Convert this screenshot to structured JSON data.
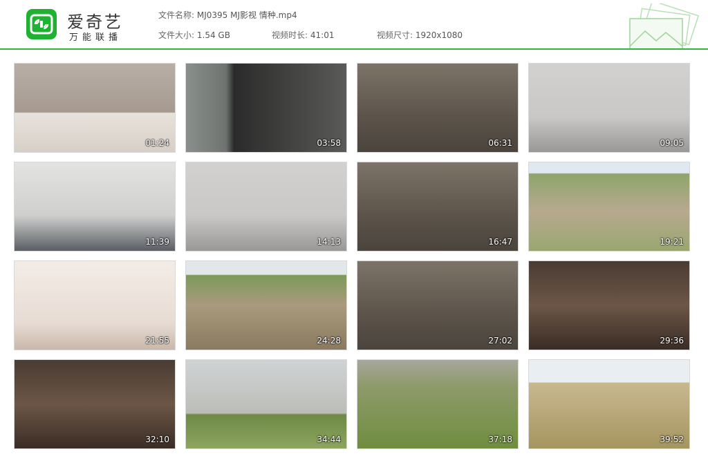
{
  "app": {
    "logo_title": "爱奇艺",
    "logo_subtitle": "万能联播",
    "brand_color": "#1fb232",
    "logo_icon": "iqiyi-tv-icon"
  },
  "file_info": {
    "name_label": "文件名称:",
    "name_value": "MJ0395 MJ影视 情种.mp4",
    "size_label": "文件大小:",
    "size_value": "1.54 GB",
    "duration_label": "视频时长:",
    "duration_value": "41:01",
    "resolution_label": "视频尺寸:",
    "resolution_value": "1920x1080"
  },
  "thumbnails": [
    {
      "time": "01:24",
      "scene": "s-bedroom"
    },
    {
      "time": "03:58",
      "scene": "s-corridor"
    },
    {
      "time": "06:31",
      "scene": "s-cell"
    },
    {
      "time": "09:05",
      "scene": "s-grayroom"
    },
    {
      "time": "11:39",
      "scene": "s-office"
    },
    {
      "time": "14:13",
      "scene": "s-grayroom"
    },
    {
      "time": "16:47",
      "scene": "s-cell"
    },
    {
      "time": "19:21",
      "scene": "s-field"
    },
    {
      "time": "21:55",
      "scene": "s-interview"
    },
    {
      "time": "24:28",
      "scene": "s-dirt"
    },
    {
      "time": "27:02",
      "scene": "s-cell"
    },
    {
      "time": "29:36",
      "scene": "s-darkroom"
    },
    {
      "time": "32:10",
      "scene": "s-darkroom"
    },
    {
      "time": "34:44",
      "scene": "s-wall"
    },
    {
      "time": "37:18",
      "scene": "s-grass"
    },
    {
      "time": "39:52",
      "scene": "s-open"
    }
  ]
}
